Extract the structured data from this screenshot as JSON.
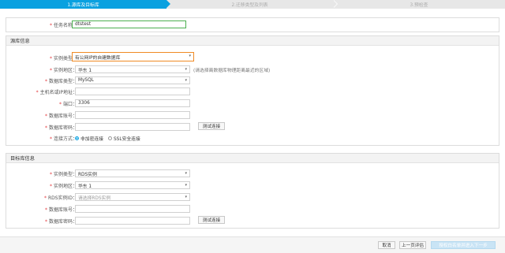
{
  "steps": [
    {
      "label": "1.源库及目标库",
      "active": true
    },
    {
      "label": "2.迁移类型及列表",
      "active": false
    },
    {
      "label": "3.预检查",
      "active": false
    }
  ],
  "task": {
    "label": "任务名称：",
    "value": "dtstest"
  },
  "source": {
    "title": "源库信息",
    "instance_type": {
      "label": "实例类型：",
      "value": "有公网IP的自建数据库"
    },
    "region": {
      "label": "实例地区：",
      "value": "华东 1",
      "hint": "(请选择离数据库物理距离最近的区域)"
    },
    "db_type": {
      "label": "数据库类型：",
      "value": "MySQL"
    },
    "host": {
      "label": "主机名或IP地址：",
      "value": ""
    },
    "port": {
      "label": "端口：",
      "value": "3306"
    },
    "account": {
      "label": "数据库账号：",
      "value": ""
    },
    "password": {
      "label": "数据库密码：",
      "value": ""
    },
    "test_button": "测试连接",
    "conn": {
      "label": "连接方式：",
      "opt1": "非加密连接",
      "opt2": "SSL安全连接"
    }
  },
  "target": {
    "title": "目标库信息",
    "instance_type": {
      "label": "实例类型：",
      "value": "RDS实例"
    },
    "region": {
      "label": "实例地区：",
      "value": "华东 1"
    },
    "rds_id": {
      "label": "RDS实例ID：",
      "placeholder": "请选择RDS实例"
    },
    "account": {
      "label": "数据库账号：",
      "value": ""
    },
    "password": {
      "label": "数据库密码：",
      "value": ""
    },
    "test_button": "测试连接"
  },
  "footer": {
    "cancel": "取消",
    "prev": "上一页评估",
    "next": "授权白名单并进入下一步"
  },
  "colors": {
    "accent": "#0aa1e0",
    "highlight": "#f08a24",
    "task_border": "#4caf50"
  }
}
